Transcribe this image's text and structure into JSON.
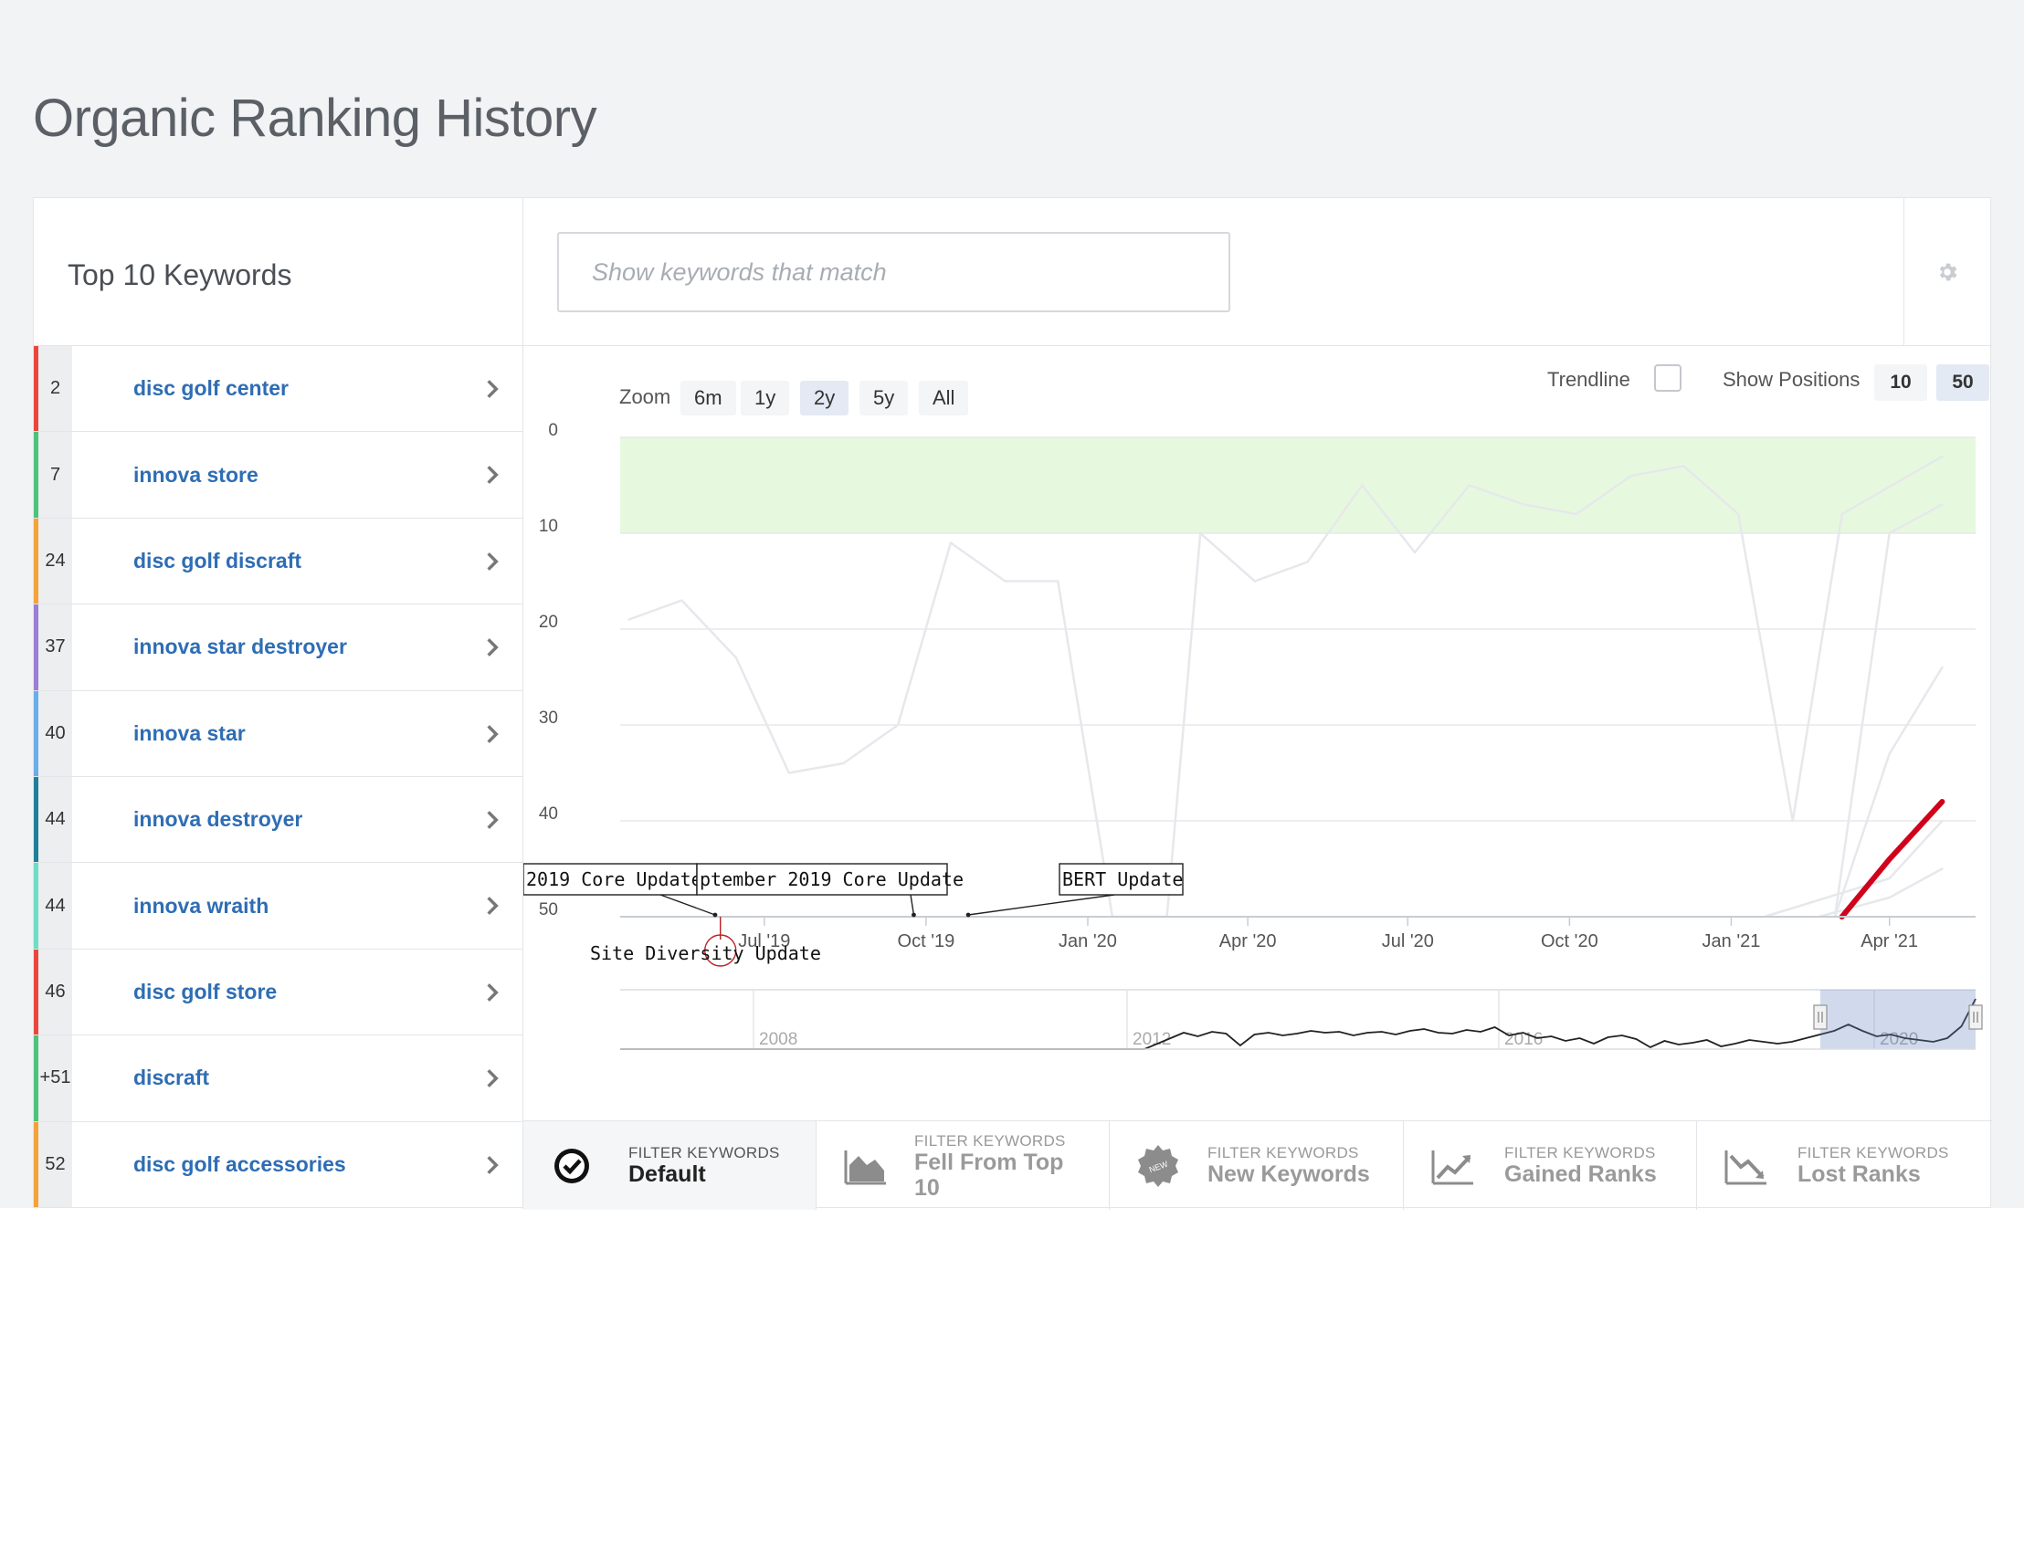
{
  "page": {
    "title": "Organic Ranking History"
  },
  "keywords_panel": {
    "title": "Top 10 Keywords",
    "items": [
      {
        "rank": "2",
        "label": "disc golf center",
        "color": "#e8473f"
      },
      {
        "rank": "7",
        "label": "innova store",
        "color": "#4cc27a"
      },
      {
        "rank": "24",
        "label": "disc golf discraft",
        "color": "#f2a33a"
      },
      {
        "rank": "37",
        "label": "innova star destroyer",
        "color": "#9b7fd4"
      },
      {
        "rank": "40",
        "label": "innova star",
        "color": "#6aaee8"
      },
      {
        "rank": "44",
        "label": "innova destroyer",
        "color": "#1e7f99"
      },
      {
        "rank": "44",
        "label": "innova wraith",
        "color": "#6fdcc4"
      },
      {
        "rank": "46",
        "label": "disc golf store",
        "color": "#e8473f"
      },
      {
        "rank": "+51",
        "label": "discraft",
        "color": "#4cc27a"
      },
      {
        "rank": "52",
        "label": "disc golf accessories",
        "color": "#f2a33a"
      }
    ]
  },
  "search": {
    "placeholder": "Show keywords that match",
    "value": ""
  },
  "toolbar": {
    "settings_icon": "gear-icon",
    "zoom_label": "Zoom",
    "zoom_options": [
      "6m",
      "1y",
      "2y",
      "5y",
      "All"
    ],
    "zoom_selected": "2y",
    "trendline_label": "Trendline",
    "trendline_checked": false,
    "show_positions_label": "Show Positions",
    "position_options": [
      "10",
      "50"
    ],
    "position_selected": "50"
  },
  "chart_data": {
    "type": "line",
    "y_axis": {
      "ticks": [
        "0",
        "10",
        "20",
        "30",
        "40",
        "50"
      ],
      "range": [
        0,
        50
      ],
      "reversed": true
    },
    "x_axis": {
      "ticks": [
        "Jul '19",
        "Oct '19",
        "Jan '20",
        "Apr '20",
        "Jul '20",
        "Oct '20",
        "Jan '21",
        "Apr '21"
      ]
    },
    "highlight_band": {
      "from": 0,
      "to": 10,
      "color": "#e6f9de"
    },
    "series": [
      {
        "color": "#e6e8ec",
        "points": [
          [
            "2019-04-15",
            19
          ],
          [
            "2019-05-15",
            17
          ],
          [
            "2019-06-15",
            23
          ],
          [
            "2019-07-15",
            35
          ],
          [
            "2019-08-15",
            34
          ],
          [
            "2019-09-15",
            30
          ],
          [
            "2019-10-15",
            11
          ],
          [
            "2019-11-15",
            15
          ],
          [
            "2019-12-15",
            15
          ],
          [
            "2020-01-15",
            50
          ],
          [
            "2020-02-15",
            50
          ],
          [
            "2020-03-05",
            10
          ],
          [
            "2020-04-05",
            15
          ],
          [
            "2020-05-05",
            13
          ],
          [
            "2020-06-05",
            5
          ],
          [
            "2020-07-05",
            12
          ],
          [
            "2020-08-05",
            5
          ],
          [
            "2020-09-05",
            7
          ],
          [
            "2020-10-05",
            8
          ],
          [
            "2020-11-05",
            4
          ],
          [
            "2020-12-05",
            3
          ],
          [
            "2021-01-05",
            8
          ],
          [
            "2021-02-05",
            40
          ],
          [
            "2021-03-05",
            8
          ],
          [
            "2021-05-01",
            2
          ]
        ]
      },
      {
        "color": "#e6e8ec",
        "points": [
          [
            "2021-03-01",
            50
          ],
          [
            "2021-04-01",
            10
          ],
          [
            "2021-05-01",
            7
          ]
        ]
      },
      {
        "color": "#e6e8ec",
        "points": [
          [
            "2021-03-01",
            50
          ],
          [
            "2021-04-01",
            33
          ],
          [
            "2021-05-01",
            24
          ]
        ]
      },
      {
        "color": "#e6e8ec",
        "points": [
          [
            "2021-01-20",
            50
          ],
          [
            "2021-04-01",
            46
          ],
          [
            "2021-05-01",
            40
          ]
        ]
      },
      {
        "color": "#e6e8ec",
        "points": [
          [
            "2021-02-20",
            50
          ],
          [
            "2021-04-01",
            48
          ],
          [
            "2021-05-01",
            45
          ]
        ]
      },
      {
        "color": "#d0021b",
        "points": [
          [
            "2021-03-05",
            50
          ],
          [
            "2021-04-01",
            44
          ],
          [
            "2021-05-01",
            38
          ]
        ]
      }
    ],
    "annotations": [
      {
        "label": "2019 Core Update",
        "date": "2019-06-03"
      },
      {
        "label": "ptember 2019 Core Update",
        "date": "2019-09-24"
      },
      {
        "label": "BERT Update",
        "date": "2019-10-25"
      },
      {
        "label": "Site Diversity Update",
        "date": "2019-06-06"
      }
    ],
    "navigator": {
      "ticks": [
        "2008",
        "2012",
        "2016",
        "2020"
      ],
      "range": [
        "2005",
        "2021"
      ],
      "selected_range": [
        "2019-04",
        "2021-05"
      ]
    }
  },
  "filters": {
    "small_label": "FILTER KEYWORDS",
    "tabs": [
      {
        "label": "Default",
        "icon": "check-circle-icon",
        "active": true
      },
      {
        "label": "Fell From Top 10",
        "icon": "area-chart-icon",
        "active": false
      },
      {
        "label": "New Keywords",
        "icon": "new-badge-icon",
        "active": false
      },
      {
        "label": "Gained Ranks",
        "icon": "trend-up-icon",
        "active": false
      },
      {
        "label": "Lost Ranks",
        "icon": "trend-down-icon",
        "active": false
      }
    ]
  }
}
